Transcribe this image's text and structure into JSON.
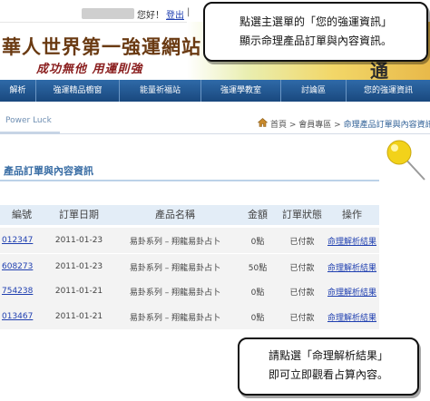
{
  "header": {
    "greeting": "您好！",
    "logout": "登出",
    "separator": "|",
    "site_title": "華人世界第一強運網站",
    "site_slogan": "成功無他 用運則強",
    "corner_glyph": "通"
  },
  "nav": {
    "items": [
      {
        "label": "解析"
      },
      {
        "label": "強運精品櫥窗"
      },
      {
        "label": "能量祈福站"
      },
      {
        "label": "強運學教室"
      },
      {
        "label": "討論區"
      },
      {
        "label": "您的強運資訊"
      }
    ]
  },
  "subbar": {
    "tab_label": "Power Luck",
    "breadcrumb_home": "首頁",
    "breadcrumb_sep1": " > ",
    "breadcrumb_mid": "會員專區",
    "breadcrumb_sep2": " > ",
    "breadcrumb_current": "命理產品訂單與內容資訊"
  },
  "section": {
    "title": "產品訂單與內容資訊"
  },
  "table": {
    "headers": [
      "編號",
      "訂單日期",
      "產品名稱",
      "金額",
      "訂單狀態",
      "操作"
    ],
    "rows": [
      {
        "id": "012347",
        "date": "2011-01-23",
        "product": "易卦系列 – 翔龍易卦占卜",
        "amount": "0點",
        "status": "已付款",
        "action": "命理解析結果"
      },
      {
        "id": "608273",
        "date": "2011-01-23",
        "product": "易卦系列 – 翔龍易卦占卜",
        "amount": "50點",
        "status": "已付款",
        "action": "命理解析結果"
      },
      {
        "id": "754238",
        "date": "2011-01-21",
        "product": "易卦系列 – 翔龍易卦占卜",
        "amount": "0點",
        "status": "已付款",
        "action": "命理解析結果"
      },
      {
        "id": "013467",
        "date": "2011-01-21",
        "product": "易卦系列 – 翔龍易卦占卜",
        "amount": "0點",
        "status": "已付款",
        "action": "命理解析結果"
      }
    ]
  },
  "callouts": {
    "top_line1": "點選主選單的「您的強運資訊」",
    "top_line2": "顯示命理產品訂單與內容資訊。",
    "bottom_line1": "請點選「命理解析結果」",
    "bottom_line2": "即可立即觀看占算內容。"
  },
  "colors": {
    "nav_bg": "#19487e",
    "link": "#1f3fb0",
    "title_brown": "#6a3a12",
    "slogan_red": "#8a1e1e",
    "section_blue": "#3a6ea5",
    "row_bg": "#f3f3f3",
    "header_bg": "#e3edf7"
  },
  "icons": {
    "home": "home-icon",
    "pin": "pushpin-icon"
  }
}
